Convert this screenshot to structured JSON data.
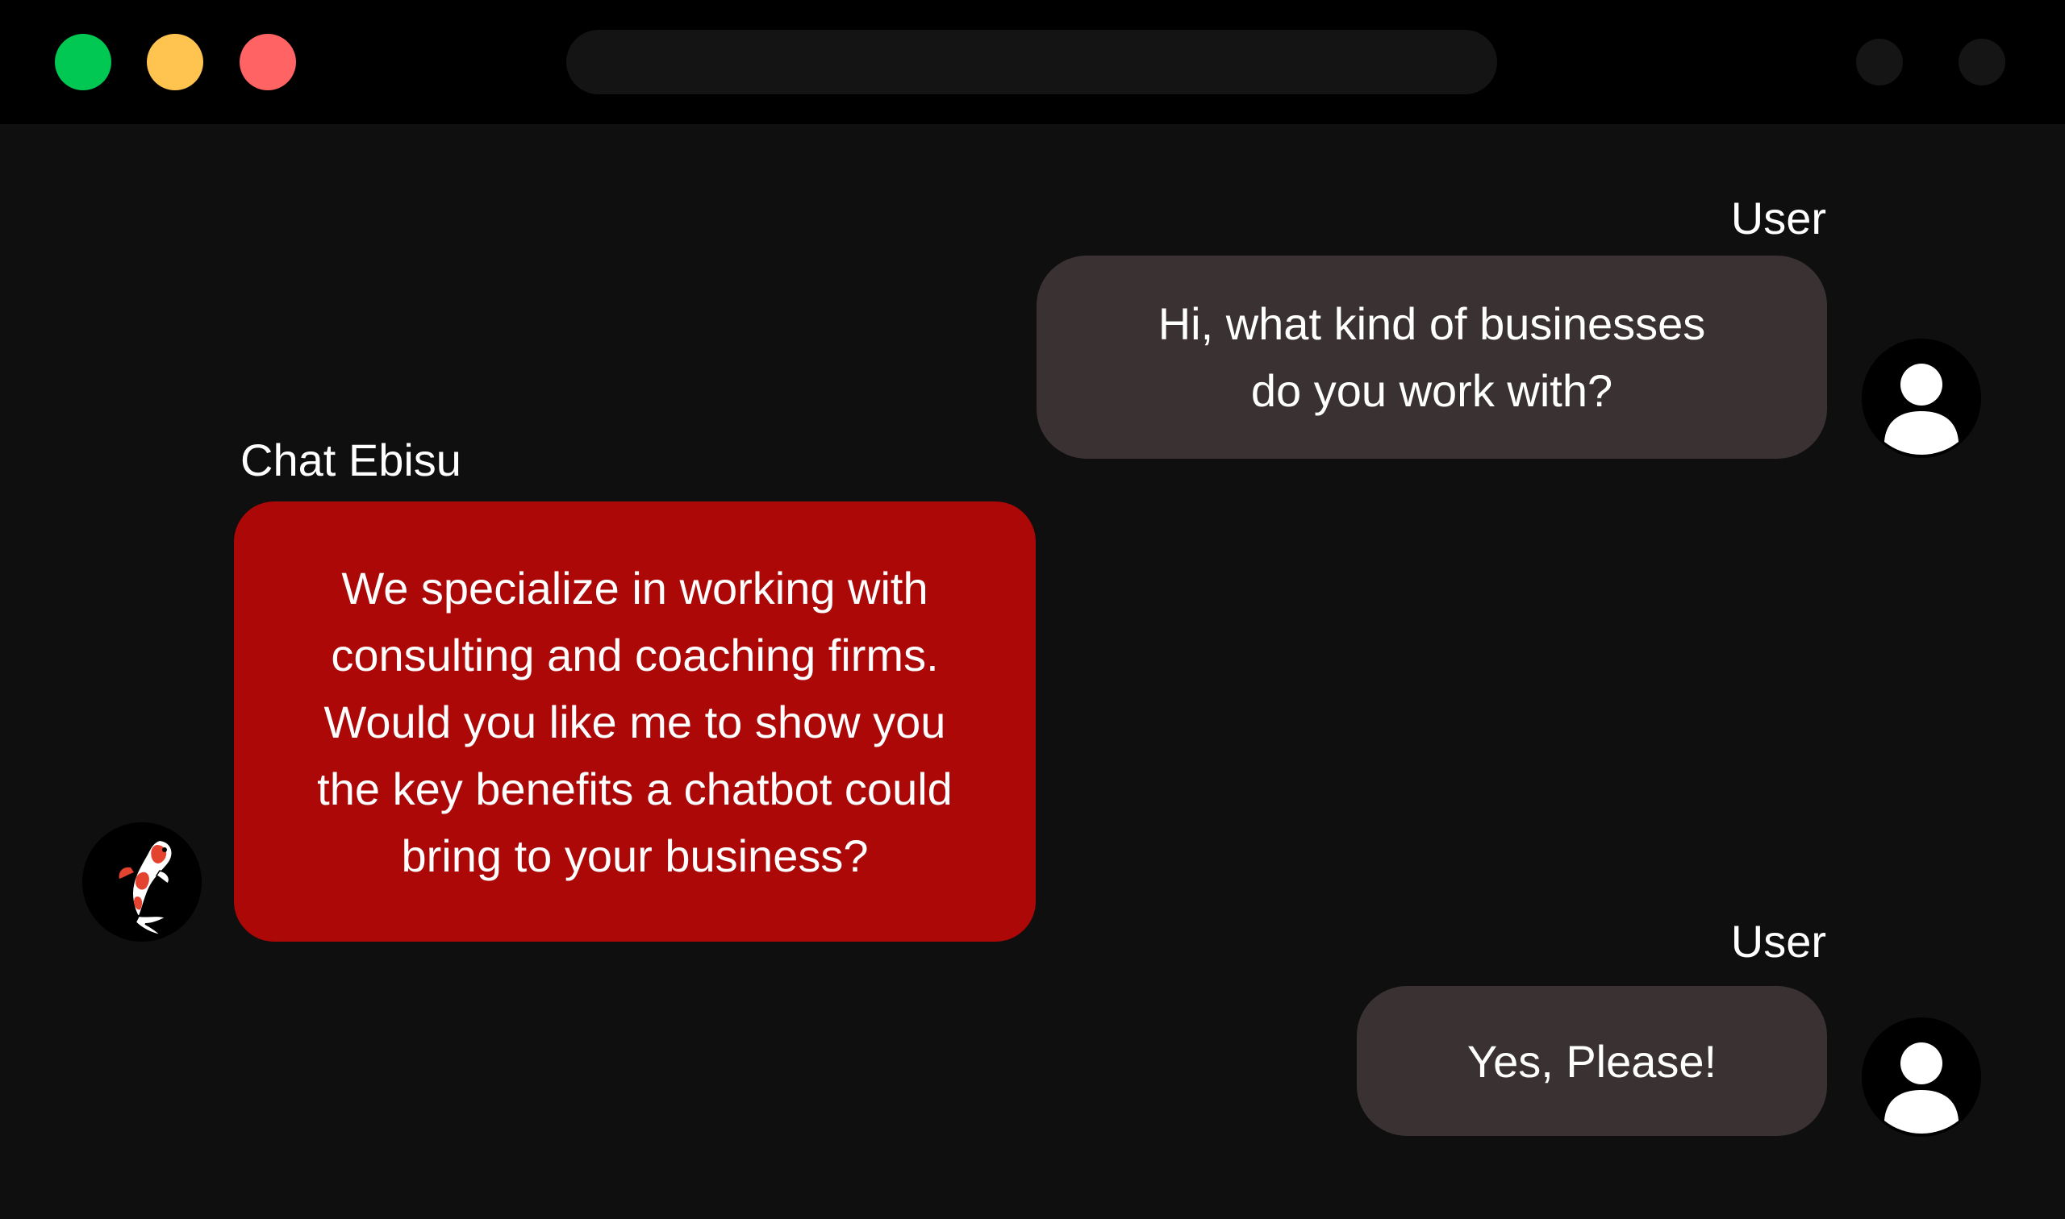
{
  "window": {
    "controls": {
      "green_color": "#00c853",
      "yellow_color": "#ffc44f",
      "red_color": "#ff6363"
    },
    "address_bar": {
      "text": ""
    }
  },
  "colors": {
    "background": "#0f0f0f",
    "titlebar": "#000000",
    "user_bubble": "#3a3232",
    "bot_bubble": "#ac0808",
    "text": "#ffffff"
  },
  "conversation": {
    "messages": [
      {
        "sender": "User",
        "role": "user",
        "text": "Hi, what kind of businesses\ndo you work with?",
        "avatar_icon": "user-icon"
      },
      {
        "sender": "Chat Ebisu",
        "role": "bot",
        "text": "We specialize in working with\nconsulting and coaching firms.\nWould you like me to show you\nthe key benefits a chatbot could\nbring to your business?",
        "avatar_icon": "koi-fish-icon"
      },
      {
        "sender": "User",
        "role": "user",
        "text": "Yes, Please!",
        "avatar_icon": "user-icon"
      }
    ]
  }
}
